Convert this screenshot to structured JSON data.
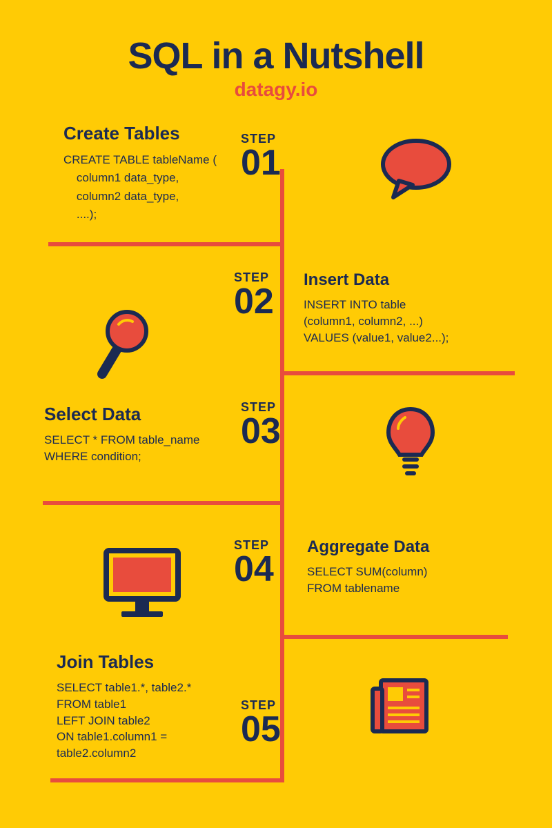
{
  "header": {
    "title": "SQL in a Nutshell",
    "subtitle": "datagy.io"
  },
  "steps": [
    {
      "label": "STEP",
      "num": "01",
      "title": "Create  Tables",
      "code": "CREATE TABLE tableName (\n    column1 data_type,\n    column2 data_type,\n    ....);"
    },
    {
      "label": "STEP",
      "num": "02",
      "title": "Insert Data",
      "code": "INSERT INTO table\n(column1, column2, ...)\nVALUES (value1, value2...);"
    },
    {
      "label": "STEP",
      "num": "03",
      "title": "Select Data",
      "code": "SELECT * FROM table_name\nWHERE condition;"
    },
    {
      "label": "STEP",
      "num": "04",
      "title": "Aggregate Data",
      "code": "SELECT SUM(column)\nFROM tablename"
    },
    {
      "label": "STEP",
      "num": "05",
      "title": "Join Tables",
      "code": "SELECT table1.*, table2.*\nFROM table1\nLEFT JOIN table2\nON table1.column1 =\ntable2.column2"
    }
  ],
  "colors": {
    "bg": "#FFCB05",
    "dark": "#1B2A52",
    "accent": "#E84C3D"
  }
}
